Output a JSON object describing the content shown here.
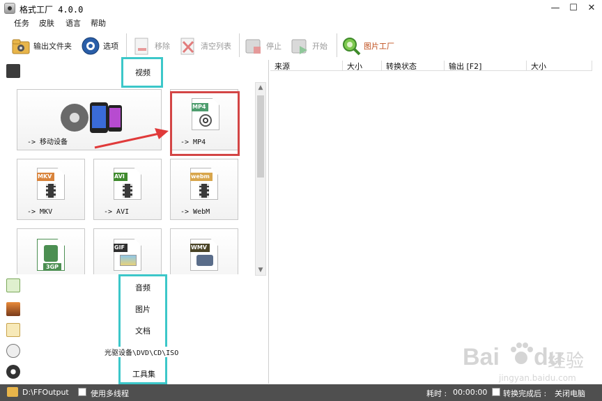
{
  "window": {
    "title": "格式工厂 4.0.0",
    "minimize_glyph": "—",
    "maximize_glyph": "☐",
    "close_glyph": "✕"
  },
  "menu": [
    {
      "label": "任务"
    },
    {
      "label": "皮肤"
    },
    {
      "label": "语言"
    },
    {
      "label": "帮助"
    }
  ],
  "toolbar": {
    "output_folder": "输出文件夹",
    "options": "选项",
    "remove": "移除",
    "clear_list": "清空列表",
    "stop": "停止",
    "start": "开始",
    "picture_factory": "图片工厂"
  },
  "categories": {
    "video": "视频",
    "audio": "音频",
    "picture": "图片",
    "document": "文档",
    "rom": "光驱设备\\DVD\\CD\\ISO",
    "tools": "工具集"
  },
  "tiles": [
    {
      "label": "-> 移动设备",
      "icon": "mobile-devices-icon"
    },
    {
      "label": "-> MP4",
      "tag": "MP4",
      "tag_color": "#4e9d6e",
      "icon": "mp4-file-icon"
    },
    {
      "label": "-> MKV",
      "tag": "MKV",
      "tag_color": "#d9843c",
      "icon": "mkv-file-icon"
    },
    {
      "label": "-> AVI",
      "tag": "AVI",
      "tag_color": "#3f8a2d",
      "icon": "avi-file-icon"
    },
    {
      "label": "-> WebM",
      "tag": "webm",
      "tag_color": "#d8a64c",
      "icon": "webm-file-icon"
    },
    {
      "label": "",
      "tag": "3GP",
      "tag_color": "#4c8f52",
      "icon": "3gp-file-icon"
    },
    {
      "label": "",
      "tag": "GIF",
      "tag_color": "#2e2e2e",
      "icon": "gif-file-icon"
    },
    {
      "label": "",
      "tag": "WMV",
      "tag_color": "#4a4426",
      "icon": "wmv-file-icon"
    }
  ],
  "file_list": {
    "columns": [
      "来源",
      "大小",
      "转换状态",
      "输出 [F2]",
      "大小"
    ]
  },
  "status": {
    "output_path": "D:\\FFOutput",
    "multithread": "使用多线程",
    "elapsed_label": "耗时 :",
    "elapsed": "00:00:00",
    "after_convert": "转换完成后 :",
    "shutdown": "关闭电脑"
  },
  "watermark": {
    "brand": "Bai",
    "brand_tail": "du",
    "product": "经验",
    "url": "jingyan.baidu.com"
  },
  "colors": {
    "highlight_cyan": "#3cc7c9",
    "highlight_red": "#d34545",
    "arrow_red": "#e03a3a",
    "statusbar": "#4f4f4f"
  }
}
